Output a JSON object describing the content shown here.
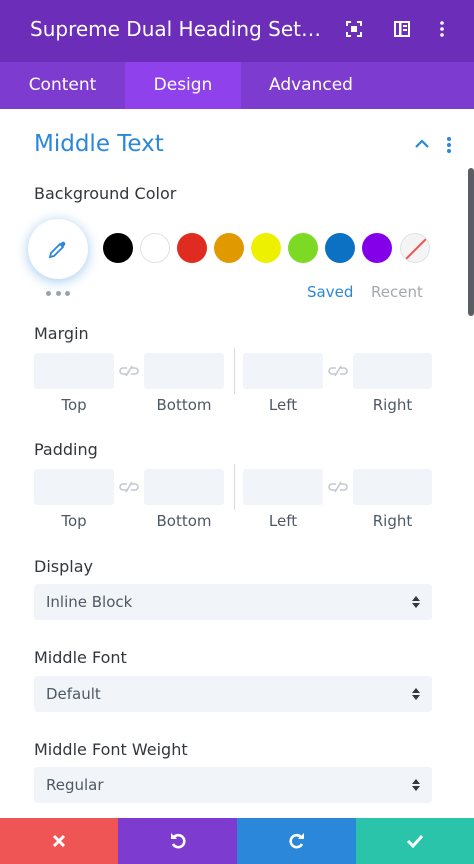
{
  "header": {
    "title": "Supreme Dual Heading Set…",
    "bg": "#6c2eb9"
  },
  "tabs": [
    {
      "label": "Content",
      "active": false
    },
    {
      "label": "Design",
      "active": true
    },
    {
      "label": "Advanced",
      "active": false
    }
  ],
  "section": {
    "title": "Middle Text"
  },
  "background_color": {
    "label": "Background Color",
    "swatches": [
      "#000000",
      "#ffffff",
      "#e02b20",
      "#e09900",
      "#edf000",
      "#7cda24",
      "#0c71c3",
      "#8300e9",
      "none"
    ],
    "saved_label": "Saved",
    "recent_label": "Recent"
  },
  "margin": {
    "label": "Margin",
    "top_label": "Top",
    "bottom_label": "Bottom",
    "left_label": "Left",
    "right_label": "Right"
  },
  "padding": {
    "label": "Padding",
    "top_label": "Top",
    "bottom_label": "Bottom",
    "left_label": "Left",
    "right_label": "Right"
  },
  "display": {
    "label": "Display",
    "value": "Inline Block"
  },
  "middle_font": {
    "label": "Middle Font",
    "value": "Default"
  },
  "middle_font_weight": {
    "label": "Middle Font Weight",
    "value": "Regular"
  },
  "footer": {
    "colors": [
      "#ef5555",
      "#7e3bd0",
      "#2b87da",
      "#29c4a9"
    ],
    "icons": [
      "close-icon",
      "undo-icon",
      "redo-icon",
      "check-icon"
    ]
  }
}
